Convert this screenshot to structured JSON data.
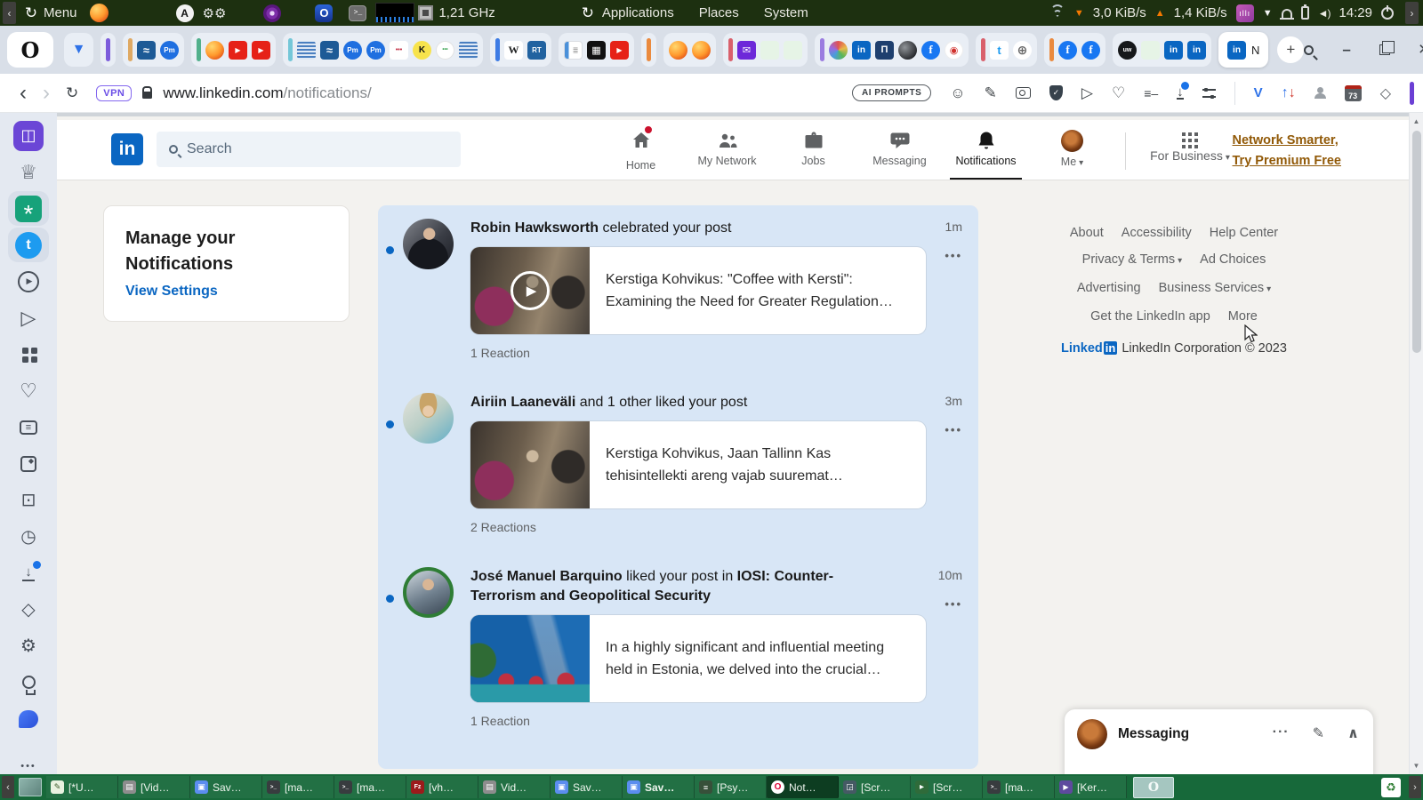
{
  "system_bar": {
    "menu": "Menu",
    "cpu_freq": "1,21 GHz",
    "menus": [
      "Applications",
      "Places",
      "System"
    ],
    "net_down": "3,0 KiB/s",
    "net_up": "1,4 KiB/s",
    "clock": "14:29"
  },
  "tab_bar": {
    "active_tab_title": "N",
    "groups": [
      {
        "icons": [
          "vivaldi"
        ]
      },
      {
        "bar": "#7c5cdb",
        "icons": []
      },
      {
        "bar": "#dfa963",
        "icons": [
          "waves-app",
          "protonmail"
        ]
      },
      {
        "bar": "#52b08c",
        "icons": [
          "firefox",
          "youtube",
          "youtube"
        ]
      },
      {
        "bar": "#74c7d8",
        "icons": [
          "waves-pattern",
          "waves-app",
          "protonmail",
          "protonmail",
          "dots-red",
          "kagi",
          "dots-green",
          "waves-pattern"
        ]
      },
      {
        "bar": "#3d7be4",
        "icons": [
          "wikipedia",
          "rt-news"
        ]
      },
      {
        "icons": [
          "doc-blue",
          "archive-dark",
          "youtube"
        ]
      },
      {
        "bar": "#ea8a3e",
        "icons": []
      },
      {
        "icons": [
          "firefox",
          "firefox"
        ]
      },
      {
        "bar": "#d9606c",
        "icons": [
          "mail-purple",
          "pale",
          "pale"
        ]
      },
      {
        "bar": "#9b7ce0",
        "icons": [
          "spiral",
          "linkedin",
          "museum",
          "sphere-dark",
          "facebook",
          "radio-red"
        ]
      },
      {
        "bar": "#d9606c",
        "icons": [
          "twitter",
          "globe"
        ]
      },
      {
        "bar": "#ea8a3e",
        "icons": [
          "facebook",
          "facebook"
        ]
      },
      {
        "icons": [
          "uw-dark",
          "pale",
          "linkedin",
          "linkedin"
        ]
      }
    ]
  },
  "address_bar": {
    "vpn_badge": "VPN",
    "url_host": "www.linkedin.com",
    "url_path": "/notifications/",
    "ai_prompts_label": "AI PROMPTS",
    "calendar_badge": "73"
  },
  "sidebar": {
    "icons": [
      "book",
      "crown",
      "chatgpt",
      "twitter",
      "play-circle",
      "send",
      "grid",
      "heart",
      "news",
      "pinboard",
      "devices",
      "history",
      "downloads",
      "extensions",
      "settings",
      "tips",
      "messenger",
      "ellipsis"
    ]
  },
  "linkedin": {
    "search_placeholder": "Search",
    "nav": [
      {
        "label": "Home"
      },
      {
        "label": "My Network"
      },
      {
        "label": "Jobs"
      },
      {
        "label": "Messaging"
      },
      {
        "label": "Notifications"
      },
      {
        "label": "Me"
      }
    ],
    "for_business": "For Business",
    "premium_line1": "Network Smarter,",
    "premium_line2": "Try Premium Free",
    "manage": {
      "title": "Manage your Notifications",
      "link": "View Settings"
    },
    "notifications": [
      {
        "actor": "Robin Hawksworth",
        "action": " celebrated your post",
        "time": "1m",
        "post": "Kerstiga Kohvikus: \"Coffee with Kersti\": Examining the Need for Greater Regulation…",
        "reactions": "1 Reaction"
      },
      {
        "actor": "Airiin Laaneväli",
        "action": " and 1 other liked your post",
        "time": "3m",
        "post": "Kerstiga Kohvikus, Jaan Tallinn Kas tehisintellekti areng vajab suuremat…",
        "reactions": "2 Reactions"
      },
      {
        "actor": "José Manuel Barquino",
        "action": " liked your post in ",
        "group": "IOSI: Counter-Terrorism and Geopolitical Security",
        "time": "10m",
        "post": "In a highly significant and influential meeting held in Estonia, we delved into the crucial…",
        "reactions": "1 Reaction"
      }
    ],
    "footer": {
      "rows": [
        [
          {
            "t": "About"
          },
          {
            "t": "Accessibility"
          },
          {
            "t": "Help Center"
          }
        ],
        [
          {
            "t": "Privacy & Terms",
            "caret": true
          },
          {
            "t": "Ad Choices"
          }
        ],
        [
          {
            "t": "Advertising"
          },
          {
            "t": "Business Services",
            "caret": true
          }
        ],
        [
          {
            "t": "Get the LinkedIn app"
          },
          {
            "t": "More"
          }
        ]
      ],
      "logo_text": "Linked",
      "logo_in": "in",
      "copyright": "LinkedIn Corporation © 2023"
    },
    "messaging_title": "Messaging"
  },
  "taskbar": {
    "items": [
      {
        "icon": "text-editor",
        "label": "[*U…"
      },
      {
        "icon": "archive",
        "label": "[Vid…"
      },
      {
        "icon": "blue-app",
        "label": "Sav…"
      },
      {
        "icon": "terminal",
        "label": "[ma…"
      },
      {
        "icon": "terminal",
        "label": "[ma…"
      },
      {
        "icon": "filezilla",
        "label": "[vh…"
      },
      {
        "icon": "archive",
        "label": "Vid…"
      },
      {
        "icon": "blue-app",
        "label": "Sav…"
      },
      {
        "icon": "blue-app",
        "label": "Sav…",
        "bold": true
      },
      {
        "icon": "dark-doc",
        "label": "[Psy…"
      },
      {
        "icon": "opera",
        "label": "Not…",
        "active": true
      },
      {
        "icon": "screenshot",
        "label": "[Scr…"
      },
      {
        "icon": "recorder",
        "label": "[Scr…"
      },
      {
        "icon": "terminal",
        "label": "[ma…"
      },
      {
        "icon": "player",
        "label": "[Ker…"
      }
    ]
  }
}
